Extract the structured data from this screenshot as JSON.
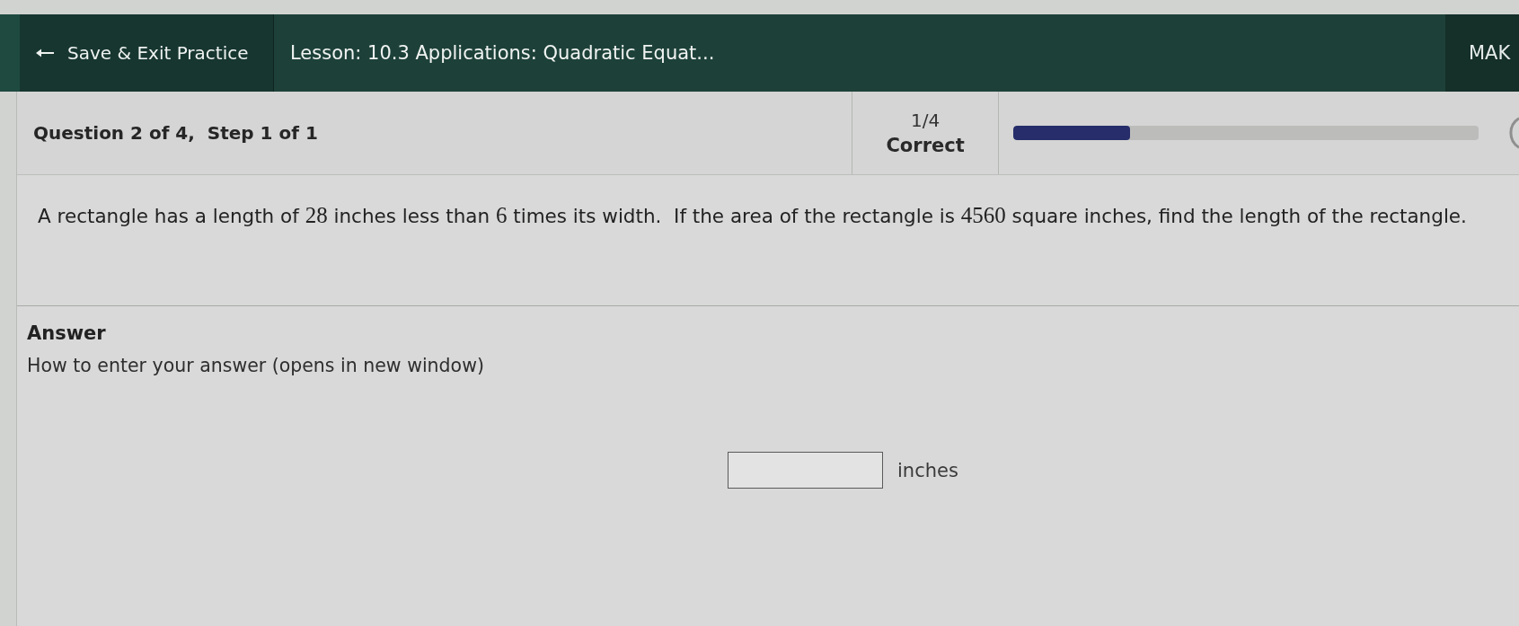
{
  "top_bar": {
    "exit_button": {
      "label": "Save & Exit Practice"
    },
    "lesson_title": "Lesson: 10.3 Applications: Quadratic Equat...",
    "right_button": {
      "label": "MAK"
    }
  },
  "progress_header": {
    "question_position": "Question 2 of 4,  Step 1 of 1",
    "score": "1/4",
    "score_label": "Correct",
    "progress": {
      "level": 0.25
    }
  },
  "question": {
    "segments": [
      {
        "kind": "text",
        "text": "A rectangle has a length of "
      },
      {
        "kind": "math",
        "text": "28"
      },
      {
        "kind": "text",
        "text": " inches less than "
      },
      {
        "kind": "math",
        "text": "6"
      },
      {
        "kind": "text",
        "text": " times its width.  If the area of the rectangle is "
      },
      {
        "kind": "math",
        "text": "4560"
      },
      {
        "kind": "text",
        "text": " square inches, find the length of the rectangle."
      }
    ]
  },
  "answer": {
    "heading": "Answer",
    "help_link": "How to enter your answer (opens in new window)",
    "field": {
      "unit": "inches"
    }
  }
}
